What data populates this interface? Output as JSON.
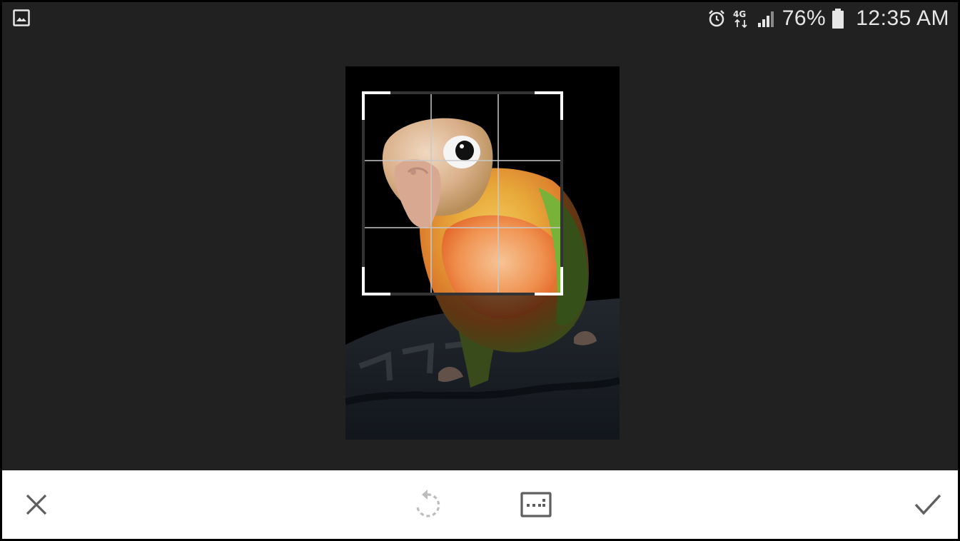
{
  "status_bar": {
    "left_icon": "gallery-image-icon",
    "icons": [
      "alarm-icon",
      "4g-data-icon",
      "signal-icon"
    ],
    "network_label": "4G",
    "battery_percent": "76%",
    "battery_icon": "battery-icon",
    "time": "12:35 AM"
  },
  "editor": {
    "mode": "crop",
    "crop_grid": "3x3",
    "photo_subject": "parrot"
  },
  "toolbar": {
    "cancel_icon": "close-icon",
    "rotate_icon": "rotate-icon",
    "rotate_enabled": false,
    "aspect_icon": "aspect-ratio-icon",
    "apply_icon": "check-icon"
  },
  "colors": {
    "background": "#212121",
    "toolbar": "#ffffff",
    "icon_dark": "#5f5f5f",
    "icon_disabled": "#bdbdbd",
    "crop_handles": "#ffffff"
  }
}
